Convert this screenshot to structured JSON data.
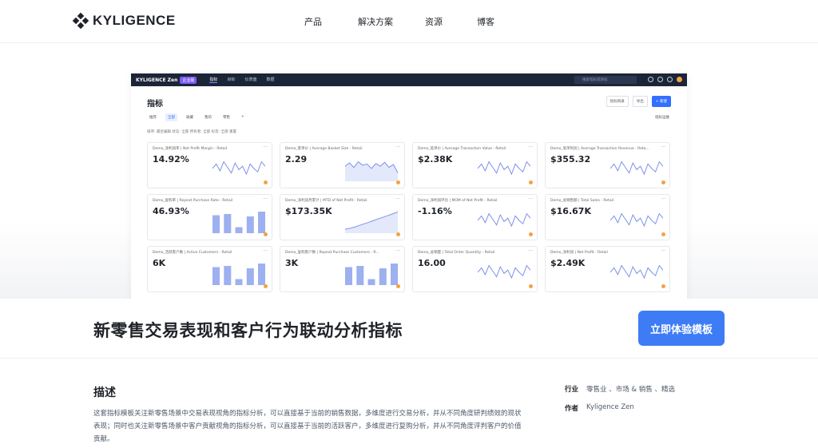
{
  "nav": {
    "logo": "KYLIGENCE",
    "items": [
      "产品",
      "解决方案",
      "资源",
      "博客"
    ]
  },
  "preview": {
    "app_logo": "KYLIGENCE Zen",
    "app_badge": "企业版",
    "tabs": [
      "指标",
      "目标",
      "仪表盘",
      "数据"
    ],
    "search_placeholder": "搜索指标或目标",
    "page_title": "指标",
    "actions": [
      "指标目录",
      "导出",
      "+ 新建"
    ],
    "filters": [
      "推荐",
      "全部",
      "收藏",
      "我的",
      "零售",
      "+"
    ],
    "manage_label": "指标运维",
    "sort_text": "排序: 最近编辑   状态: 全部   所有者: 全部   标签: 全部   重置",
    "cards": [
      {
        "name": "Demo_净利润率 | Net Profit Margin - Retail",
        "value": "14.92%",
        "chart": "line"
      },
      {
        "name": "Demo_客单价 | Average Basket Size - Retail",
        "value": "2.29",
        "chart": "area"
      },
      {
        "name": "Demo_笔单价 | Average Transaction Value - Retail",
        "value": "$2.38K",
        "chart": "line"
      },
      {
        "name": "Demo_笔单利润 | Average Transaction Revenue - Reta...",
        "value": "$355.32",
        "chart": "line"
      },
      {
        "name": "Demo_复购率 | Repeat Purchase Rate - Retail",
        "value": "46.93%",
        "chart": "bar"
      },
      {
        "name": "Demo_净利润月累计 | MTD of Net Profit - Retail",
        "value": "$173.35K",
        "chart": "rise"
      },
      {
        "name": "Demo_净利润环比 | MOM of Net Profit - Retail",
        "value": "-1.16%",
        "chart": "line"
      },
      {
        "name": "Demo_总销售额 | Total Sales - Retail",
        "value": "$16.67K",
        "chart": "line"
      },
      {
        "name": "Demo_活跃客户数 | Active Customers - Retail",
        "value": "6K",
        "chart": "bar"
      },
      {
        "name": "Demo_复购客户数 | Repeat Purchase Customers - R...",
        "value": "3K",
        "chart": "bar"
      },
      {
        "name": "Demo_总销量 | Total Order Quantity - Retail",
        "value": "16.00",
        "chart": "line"
      },
      {
        "name": "Demo_净利润 | Net Profit - Retail",
        "value": "$2.49K",
        "chart": "line"
      }
    ]
  },
  "title": "新零售交易表现和客户行为联动分析指标",
  "cta_label": "立即体验模板",
  "description": {
    "heading": "描述",
    "body": "这套指标模板关注新零售场景中交易表现视角的指标分析，可以直接基于当前的销售数据，多维度进行交易分析，并从不同角度研判绩效的现状表现；同时也关注新零售场景中客户贡献视角的指标分析，可以直接基于当前的活跃客户，多维度进行复购分析，并从不同角度评判客户的价值贡献。"
  },
  "meta": {
    "industry_label": "行业",
    "industry_value": "零售业 、市场 & 销售 、精选",
    "author_label": "作者",
    "author_value": "Kyligence Zen"
  },
  "colors": {
    "accent": "#3d7cf5",
    "spark": "#7b93ea",
    "bar": "#9db0ef",
    "dot": "#f5a142",
    "app_bar": "#1b2537"
  }
}
